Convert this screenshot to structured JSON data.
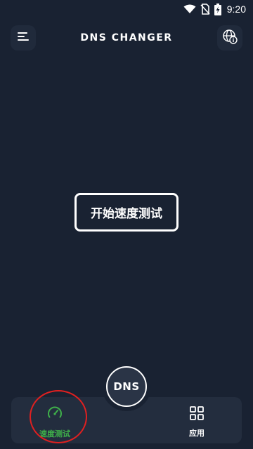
{
  "status_bar": {
    "time": "9:20",
    "icons": [
      "wifi-icon",
      "no-sim-icon",
      "battery-charging-icon"
    ]
  },
  "header": {
    "title": "DNS CHANGER",
    "menu_icon": "hamburger-menu-icon",
    "info_icon": "globe-info-icon"
  },
  "main": {
    "start_button_label": "开始速度测试"
  },
  "dns_fab": {
    "label": "DNS"
  },
  "bottom_nav": {
    "items": [
      {
        "label": "速度测试",
        "icon": "speedometer-icon",
        "active": true
      },
      {
        "label": "应用",
        "icon": "grid-apps-icon",
        "active": false
      }
    ]
  },
  "colors": {
    "background": "#192232",
    "accent_active": "#3fb04a",
    "highlight": "#e02020"
  }
}
